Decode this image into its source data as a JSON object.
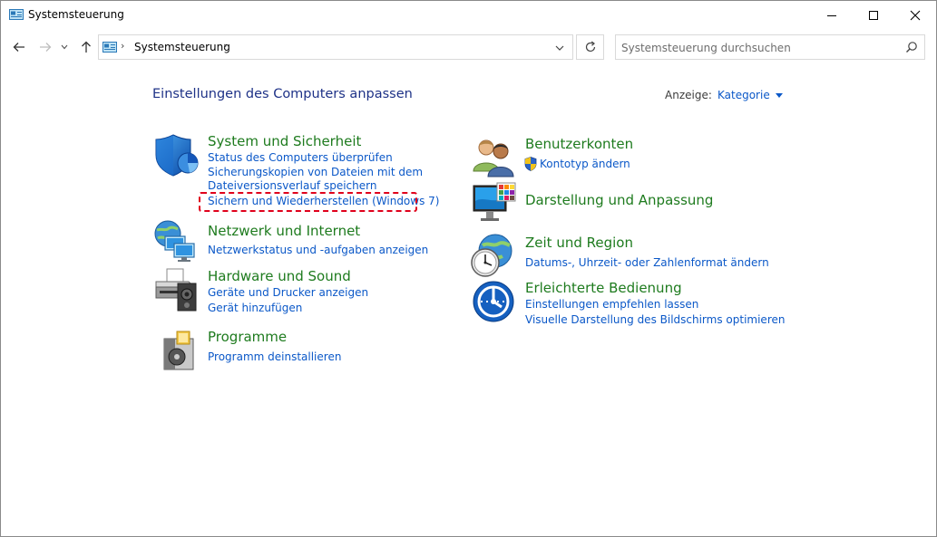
{
  "window": {
    "title": "Systemsteuerung",
    "minimize_label": "Minimieren",
    "maximize_label": "Maximieren",
    "close_label": "Schließen"
  },
  "address": {
    "path": "Systemsteuerung"
  },
  "search": {
    "placeholder": "Systemsteuerung durchsuchen"
  },
  "content": {
    "heading": "Einstellungen des Computers anpassen",
    "view_label": "Anzeige:",
    "view_value": "Kategorie"
  },
  "left_categories": [
    {
      "title": "System und Sicherheit",
      "icon": "shield-icon",
      "links": [
        "Status des Computers überprüfen",
        "Sicherungskopien von Dateien mit dem",
        "Dateiversionsverlauf speichern",
        "Sichern und Wiederherstellen (Windows 7)"
      ]
    },
    {
      "title": "Netzwerk und Internet",
      "icon": "network-icon",
      "links": [
        "Netzwerkstatus und -aufgaben anzeigen"
      ]
    },
    {
      "title": "Hardware und Sound",
      "icon": "printer-icon",
      "links": [
        "Geräte und Drucker anzeigen",
        "Gerät hinzufügen"
      ]
    },
    {
      "title": "Programme",
      "icon": "programs-icon",
      "links": [
        "Programm deinstallieren"
      ]
    }
  ],
  "right_categories": [
    {
      "title": "Benutzerkonten",
      "icon": "users-icon",
      "links": [
        "Kontotyp ändern"
      ]
    },
    {
      "title": "Darstellung und Anpassung",
      "icon": "display-icon",
      "links": []
    },
    {
      "title": "Zeit und Region",
      "icon": "clock-globe-icon",
      "links": [
        "Datums-, Uhrzeit- oder Zahlenformat ändern"
      ]
    },
    {
      "title": "Erleichterte Bedienung",
      "icon": "accessibility-icon",
      "links": [
        "Einstellungen empfehlen lassen",
        "Visuelle Darstellung des Bildschirms optimieren"
      ]
    }
  ],
  "colors": {
    "heading": "#1e3287",
    "category_title": "#1e7b1e",
    "link": "#0b58c8",
    "highlight": "#e0001b"
  }
}
